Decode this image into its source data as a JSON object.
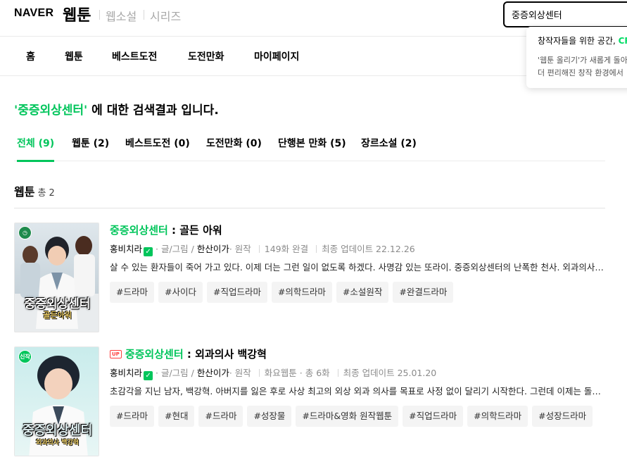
{
  "header": {
    "naver_logo": "NAVER",
    "webtoon_logo": "웹툰",
    "services": [
      "웹소설",
      "시리즈"
    ],
    "search_value": "중증외상센터"
  },
  "popup": {
    "title_prefix": "창작자들을 위한 공간, ",
    "title_highlight": "CR",
    "line1": "'웹툰 올리기'가 새롭게 돌아",
    "line2": "더 편리해진 창작 환경에서"
  },
  "nav": [
    "홈",
    "웹툰",
    "베스트도전",
    "도전만화",
    "마이페이지"
  ],
  "search_result": {
    "query_label": "'중증외상센터'",
    "suffix": " 에 대한 검색결과 입니다."
  },
  "tabs": [
    {
      "label": "전체 (9)",
      "active": true
    },
    {
      "label": "웹툰 (2)",
      "active": false
    },
    {
      "label": "베스트도전 (0)",
      "active": false
    },
    {
      "label": "도전만화 (0)",
      "active": false
    },
    {
      "label": "단행본 만화 (5)",
      "active": false
    },
    {
      "label": "장르소설 (2)",
      "active": false
    }
  ],
  "section": {
    "title": "웹툰",
    "count": "총 2"
  },
  "results": [
    {
      "thumb_badge": "",
      "thumb_title": "중증외상센터",
      "thumb_subtitle": "골든아워",
      "up": false,
      "title_highlight": "중증외상센터",
      "title_rest": " : 골든 아워",
      "author": "홍비치라",
      "role": "· 글/그림 / ",
      "coauthor": "한산이가",
      "coauthor_role": "· 원작",
      "info1": "149화 완결",
      "info2": "",
      "updated": "최종 업데이트 22.12.26",
      "description": "살 수 있는 환자들이 죽어 가고 있다. 이제 더는 그런 일이 없도록 하겠다. 사명감 있는 또라이. 중증외상센터의 난폭한 천사. 외과의사 백강혁이 이끄는 중증외상센터 이야기",
      "tags": [
        "#드라마",
        "#사이다",
        "#직업드라마",
        "#의학드라마",
        "#소설원작",
        "#완결드라마"
      ]
    },
    {
      "thumb_badge": "신작",
      "thumb_title": "중증외상센터",
      "thumb_subtitle": "외과의사 백강혁",
      "up": true,
      "up_label": "UP",
      "title_highlight": "중증외상센터",
      "title_rest": " : 외과의사 백강혁",
      "author": "홍비치라",
      "role": "· 글/그림 / ",
      "coauthor": "한산이가",
      "coauthor_role": "· 원작",
      "info1": "화요웹툰",
      "info2": "· 총 6화",
      "updated": "최종 업데이트 25.01.20",
      "description": "초감각을 지닌 남자, 백강혁. 아버지를 잃은 후로 사상 최고의 외상 외과 의사를 목표로 사정 없이 달리기 시작한다. 그런데 이제는 돌이킬 수 없다",
      "tags": [
        "#드라마",
        "#현대",
        "#드라마",
        "#성장물",
        "#드라마&영화 원작웹툰",
        "#직업드라마",
        "#의학드라마",
        "#성장드라마"
      ]
    }
  ],
  "colors": {
    "brand_green": "#00c55b",
    "up_red": "#ff3e3e"
  }
}
